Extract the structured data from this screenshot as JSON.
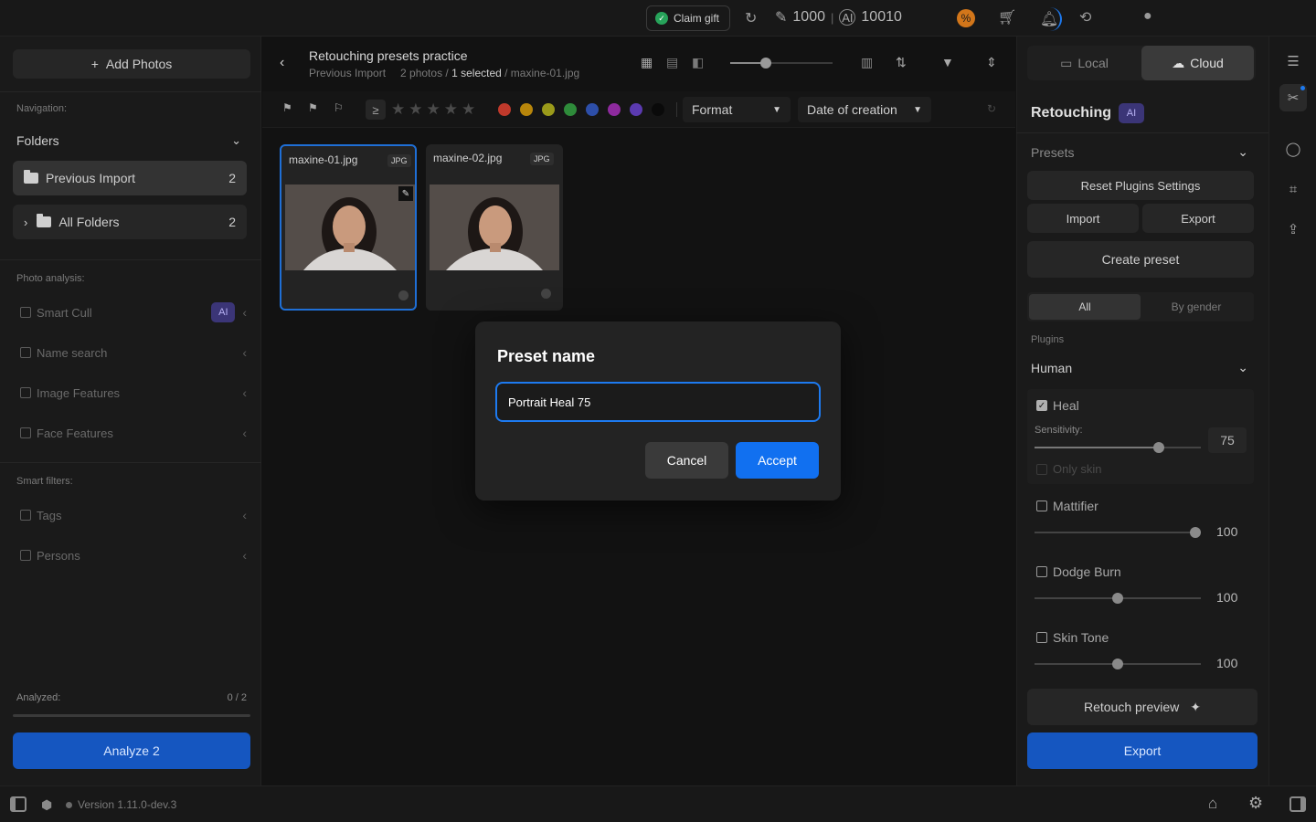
{
  "topbar": {
    "claim_gift": "Claim gift",
    "credits_magic": "1000",
    "separator": "|",
    "credits_ai": "10010"
  },
  "left": {
    "add_photos": "Add Photos",
    "navigation_label": "Navigation:",
    "folders_label": "Folders",
    "folders": [
      {
        "label": "Previous Import",
        "count": "2"
      },
      {
        "label": "All Folders",
        "count": "2"
      }
    ],
    "photo_analysis_label": "Photo analysis:",
    "analysis_items": [
      "Smart Cull",
      "Name search",
      "Image Features",
      "Face Features"
    ],
    "ai_badge": "AI",
    "smart_filters_label": "Smart filters:",
    "smart_filters": [
      "Tags",
      "Persons"
    ],
    "analyzed_label": "Analyzed:",
    "analyzed_value": "0 / 2",
    "analyzed_fraction": 0,
    "analyze_button": "Analyze 2"
  },
  "center": {
    "title": "Retouching presets practice",
    "breadcrumb_folder": "Previous Import",
    "breadcrumb_count": "2 photos /",
    "breadcrumb_selected": "1 selected",
    "breadcrumb_file": "/ maxine-01.jpg",
    "ge_symbol": "≥",
    "format_label": "Format",
    "date_label": "Date of creation",
    "color_labels": [
      "#c0392b",
      "#b8860b",
      "#9a9a1a",
      "#2e8b3a",
      "#2d4ea8",
      "#8e2a9e",
      "#5b3ab0",
      "#0a0a0a"
    ],
    "photos": [
      {
        "name": "maxine-01.jpg",
        "type": "JPG",
        "selected": true
      },
      {
        "name": "maxine-02.jpg",
        "type": "JPG",
        "selected": false
      }
    ]
  },
  "modal": {
    "title": "Preset name",
    "input_value": "Portrait Heal 75",
    "cancel": "Cancel",
    "accept": "Accept"
  },
  "right": {
    "tab_local": "Local",
    "tab_cloud": "Cloud",
    "section_title": "Retouching",
    "ai_badge": "AI",
    "presets_label": "Presets",
    "reset_plugins": "Reset Plugins Settings",
    "import": "Import",
    "export_small": "Export",
    "create_preset": "Create preset",
    "filter_all": "All",
    "filter_gender": "By gender",
    "plugins_label": "Plugins",
    "plugin_group": "Human",
    "heal": {
      "label": "Heal",
      "checked": true,
      "sensitivity_label": "Sensitivity:",
      "value": "75",
      "only_skin": "Only skin"
    },
    "mattifier": {
      "label": "Mattifier",
      "value": "100"
    },
    "dodge_burn": {
      "label": "Dodge Burn",
      "value": "100"
    },
    "skin_tone": {
      "label": "Skin Tone",
      "value": "100"
    },
    "retouch_preview": "Retouch preview",
    "export": "Export"
  },
  "bottombar": {
    "version": "Version 1.11.0-dev.3"
  },
  "icons": {
    "accent": "#1170f0",
    "ai_purple": "#3b3577"
  }
}
